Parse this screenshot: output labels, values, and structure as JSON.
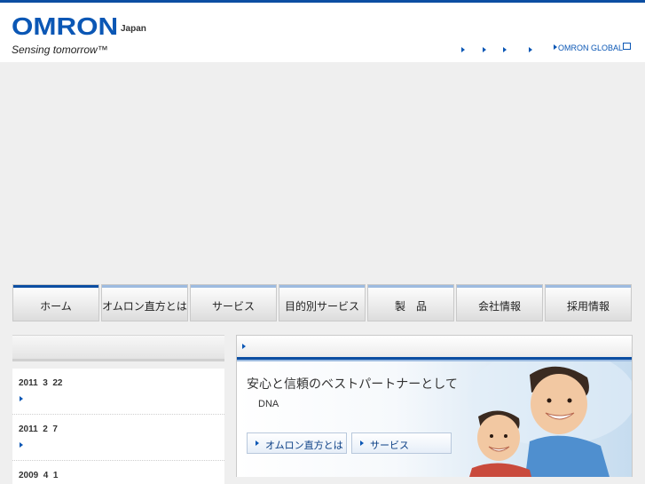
{
  "header": {
    "logo": "OMRON",
    "region": "Japan",
    "tagline": "Sensing tomorrow™",
    "global_link": "OMRON GLOBAL"
  },
  "gnav": {
    "items": [
      {
        "label": "ホーム",
        "active": true
      },
      {
        "label": "オムロン直方とは",
        "active": false
      },
      {
        "label": "サービス",
        "active": false
      },
      {
        "label": "目的別サービス",
        "active": false
      },
      {
        "label": "製　品",
        "active": false
      },
      {
        "label": "会社情報",
        "active": false
      },
      {
        "label": "採用情報",
        "active": false
      }
    ]
  },
  "news": {
    "items": [
      {
        "date": "2011  3  22"
      },
      {
        "date": "2011  2  7"
      },
      {
        "date": "2009  4  1"
      }
    ]
  },
  "feature": {
    "title": "安心と信頼のベストパートナーとして",
    "subtitle": "DNA",
    "buttons": [
      {
        "label": "オムロン直方とは"
      },
      {
        "label": "サービス"
      }
    ]
  },
  "colors": {
    "brand_blue": "#0b57b5",
    "nav_active": "#0c4ea2",
    "nav_inactive": "#9dbbe0"
  }
}
